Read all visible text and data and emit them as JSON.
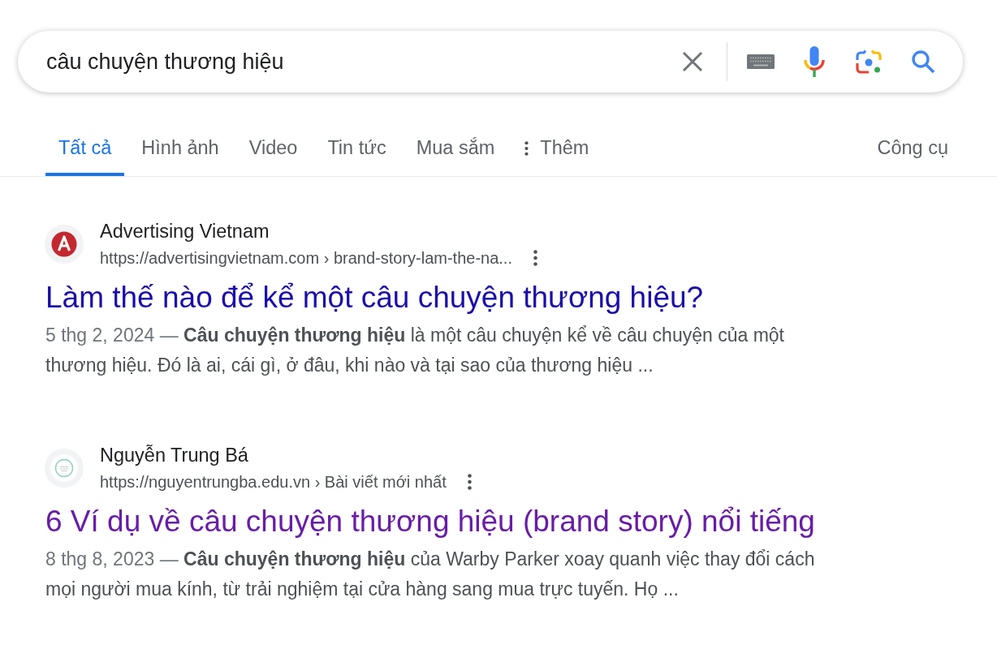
{
  "search": {
    "query": "câu chuyện thương hiệu"
  },
  "tabs": [
    {
      "label": "Tất cả",
      "selected": true,
      "kind": "plain"
    },
    {
      "label": "Hình ảnh",
      "selected": false,
      "kind": "plain"
    },
    {
      "label": "Video",
      "selected": false,
      "kind": "plain"
    },
    {
      "label": "Tin tức",
      "selected": false,
      "kind": "plain"
    },
    {
      "label": "Mua sắm",
      "selected": false,
      "kind": "plain"
    },
    {
      "label": "Thêm",
      "selected": false,
      "kind": "more"
    }
  ],
  "tools_button": "Công cụ",
  "results": [
    {
      "kind": "red-disc",
      "site": "Advertising Vietnam",
      "url": "https://advertisingvietnam.com › brand-story-lam-the-na...",
      "title": "Làm thế nào để kể một câu chuyện thương hiệu?",
      "visited": false,
      "date": "5 thg 2, 2024 —",
      "snippet": "**Câu chuyện thương hiệu** là một câu chuyện kể về câu chuyện của một thương hiệu. Đó là ai, cái gì, ở đâu, khi nào và tại sao của thương hiệu ..."
    },
    {
      "kind": "green-ring",
      "site": "Nguyễn Trung Bá",
      "url": "https://nguyentrungba.edu.vn › Bài viết mới nhất",
      "title": "6 Ví dụ về câu chuyện thương hiệu (brand story) nổi tiếng",
      "visited": true,
      "date": "8 thg 8, 2023 —",
      "snippet": "**Câu chuyện thương hiệu** của Warby Parker xoay quanh việc thay đổi cách mọi người mua kính, từ trải nghiệm tại cửa hàng sang mua trực tuyến. Họ ..."
    }
  ]
}
